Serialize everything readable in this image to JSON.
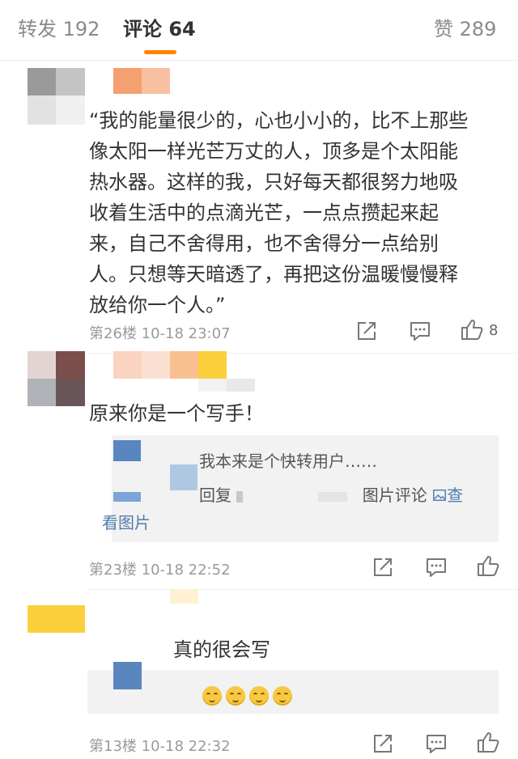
{
  "tabs": {
    "repost": "转发 192",
    "comments": "评论 64",
    "likes": "赞 289"
  },
  "comments": [
    {
      "lines": [
        "“我的能量很少的，心也小小的，比不上那些",
        "像太阳一样光芒万丈的人，顶多是个太阳能",
        "热水器。这样的我，只好每天都很努力地吸",
        "收着生活中的点滴光芒，一点点攒起来起",
        "来，自己不舍得用，也不舍得分一点给别",
        "人。只想等天暗透了，再把这份温暖慢慢释",
        "放给你一个人。”"
      ],
      "meta": "第26楼  10-18 23:07",
      "like_count": "8"
    },
    {
      "text": "原来你是一个写手！",
      "reply": {
        "line1": "我本来是个快转用户……",
        "line2_prefix": "回复",
        "line2_suffix": "图片评论",
        "view_image_a": "查",
        "view_image_b": "看图片"
      },
      "meta": "第23楼  10-18 22:52"
    },
    {
      "text": "真的很会写",
      "meta": "第13楼  10-18 22:32"
    }
  ],
  "icons": {
    "share": "share-icon",
    "comment": "comment-icon",
    "like": "thumbs-up-icon",
    "image": "image-icon"
  },
  "colors": {
    "accent": "#ff8200",
    "link": "#507daf",
    "text": "#333333",
    "meta": "#9a9a9a"
  }
}
